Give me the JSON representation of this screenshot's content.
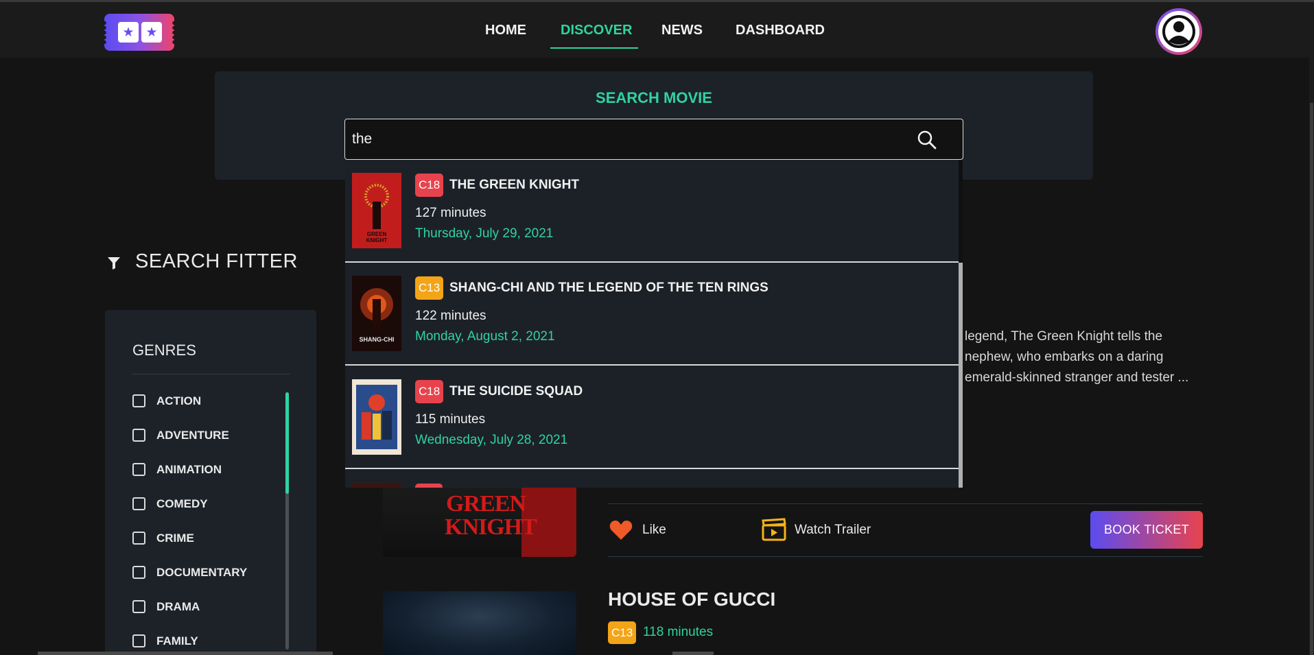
{
  "nav": {
    "items": [
      {
        "label": "HOME",
        "active": false
      },
      {
        "label": "DISCOVER",
        "active": true
      },
      {
        "label": "NEWS",
        "active": false
      },
      {
        "label": "DASHBOARD",
        "active": false
      }
    ]
  },
  "search": {
    "title": "SEARCH MOVIE",
    "value": "the",
    "results": [
      {
        "rating": "C18",
        "title": "THE GREEN KNIGHT",
        "duration": "127 minutes",
        "date": "Thursday, July 29, 2021",
        "poster_text": "THE\nGREEN\nKNIGHT"
      },
      {
        "rating": "C13",
        "title": "SHANG-CHI AND THE LEGEND OF THE TEN RINGS",
        "duration": "122 minutes",
        "date": "Monday, August 2, 2021",
        "poster_text": "SHANG-CHI"
      },
      {
        "rating": "C18",
        "title": "THE SUICIDE SQUAD",
        "duration": "115 minutes",
        "date": "Wednesday, July 28, 2021",
        "poster_text": ""
      }
    ]
  },
  "filter": {
    "heading": "SEARCH FITTER",
    "genres_heading": "GENRES",
    "genres": [
      "ACTION",
      "ADVENTURE",
      "ANIMATION",
      "COMEDY",
      "CRIME",
      "DOCUMENTARY",
      "DRAMA",
      "FAMILY"
    ]
  },
  "featured": {
    "description_lines": [
      "legend, The Green Knight tells the",
      "nephew, who embarks on a daring",
      "emerald-skinned stranger and tester ..."
    ],
    "poster_text": "GREEN\nKNIGHT",
    "like_label": "Like",
    "trailer_label": "Watch Trailer",
    "book_label": "BOOK TICKET"
  },
  "next_movie": {
    "title": "HOUSE OF GUCCI",
    "rating": "C13",
    "duration": "118 minutes"
  },
  "colors": {
    "accent": "#2fd4a0",
    "c18": "#e8434d",
    "c13": "#f4a417",
    "gradient_start": "#5b4cf0",
    "gradient_end": "#e8434d"
  }
}
